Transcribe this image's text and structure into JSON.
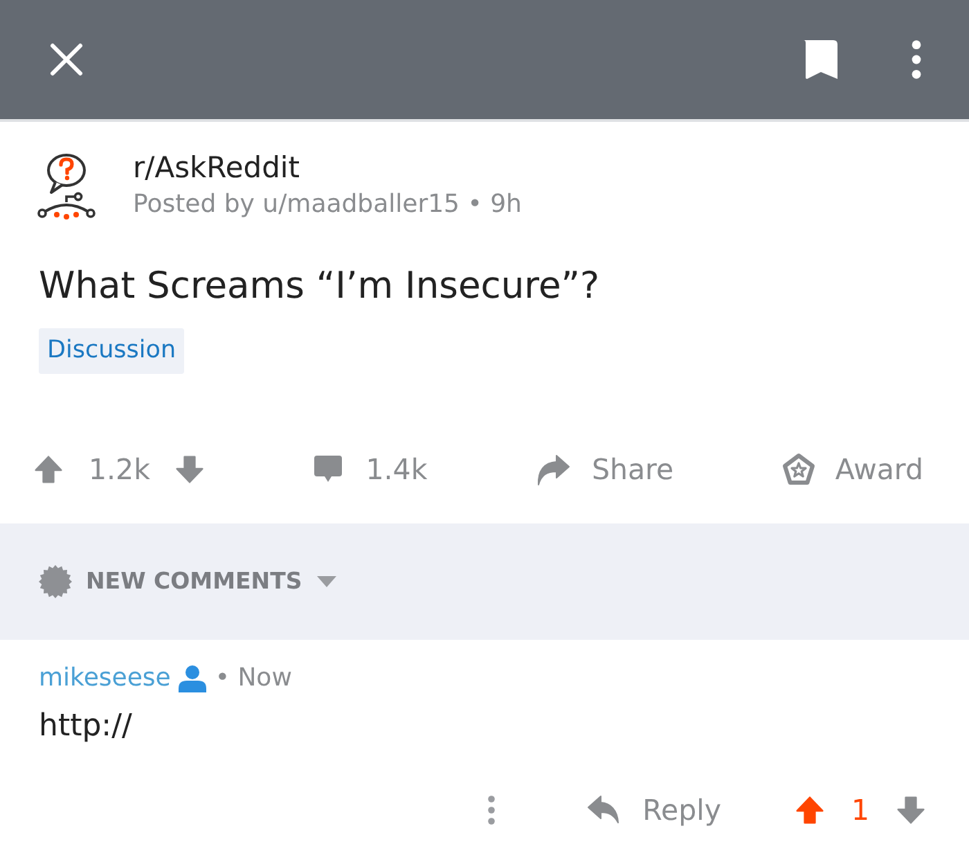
{
  "post": {
    "subreddit": "r/AskReddit",
    "byline": "Posted by u/maadballer15 • 9h",
    "title": "What Screams “I’m Insecure”?",
    "flair": "Discussion",
    "score": "1.2k",
    "upvoted": false,
    "downvoted": false,
    "comments": "1.4k",
    "share": "Share",
    "award": "Award"
  },
  "comments_header": {
    "label": "NEW COMMENTS"
  },
  "comments": [
    {
      "author": "mikeseese",
      "time": "• Now",
      "body": "http://",
      "reply": "Reply",
      "score": "1",
      "upvoted": true,
      "downvoted": false
    }
  ]
}
